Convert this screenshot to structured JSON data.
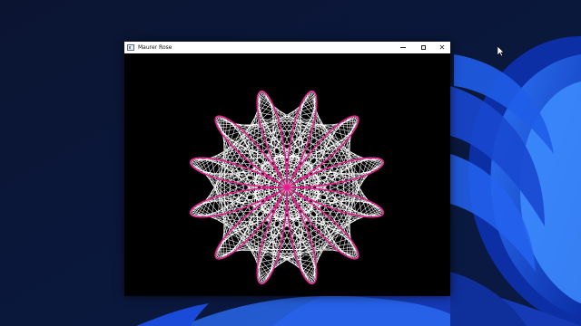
{
  "window": {
    "title": "Maurer Rose",
    "controls": {
      "minimize": "minimize-icon",
      "maximize": "maximize-icon",
      "close": "close-icon"
    },
    "canvas_background": "#000000"
  },
  "rose": {
    "n": 6,
    "d": 71,
    "line_color": "#ffffff",
    "curve_color": "#e0208c"
  },
  "desktop": {
    "background_color": "#0a1330",
    "accent": "#1c46d8"
  }
}
